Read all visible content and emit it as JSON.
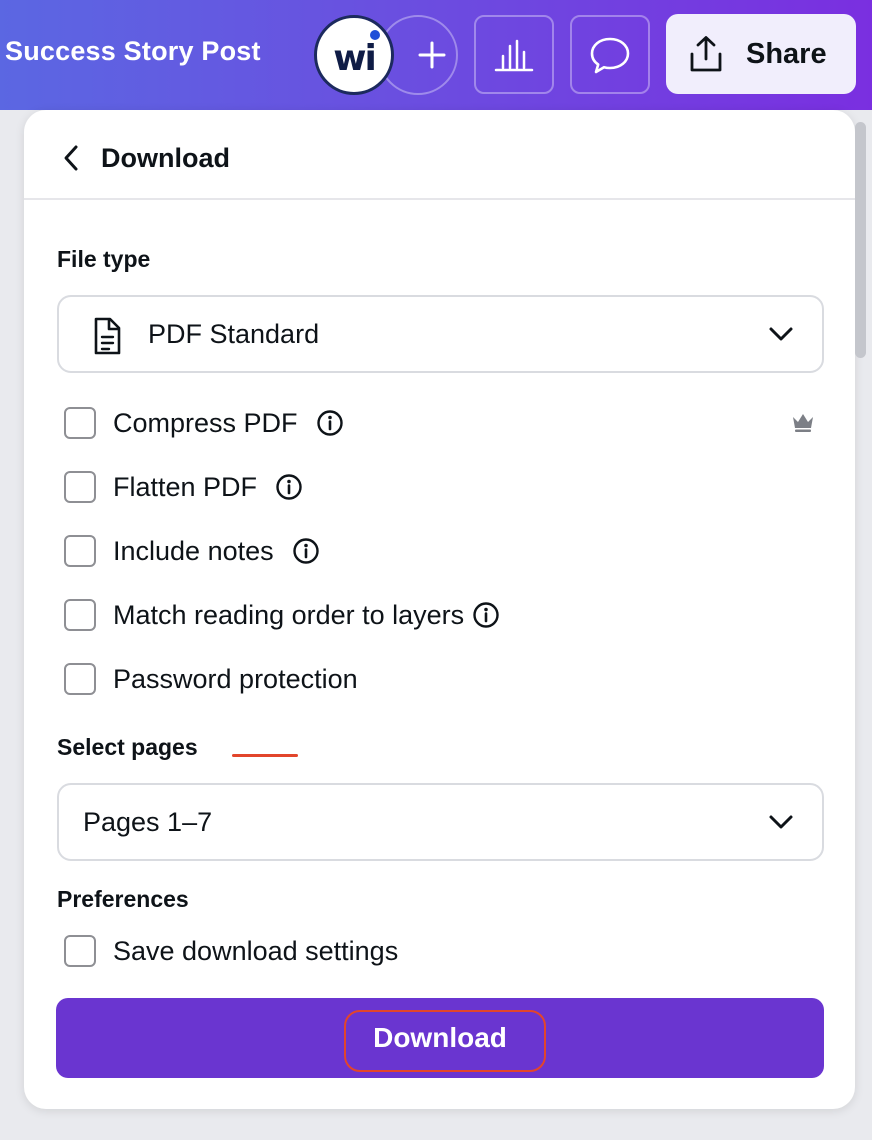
{
  "topbar": {
    "doc_title": "Success Story Post",
    "avatar_initials": "wi",
    "share_label": "Share",
    "icons": [
      "plus-icon",
      "analytics-icon",
      "comment-icon",
      "share-upload-icon"
    ]
  },
  "panel": {
    "title": "Download",
    "file_type": {
      "label": "File type",
      "selected": "PDF Standard",
      "icon": "document-icon"
    },
    "options": [
      {
        "label": "Compress PDF",
        "checked": false,
        "info": true,
        "premium": true
      },
      {
        "label": "Flatten PDF",
        "checked": false,
        "info": true
      },
      {
        "label": "Include notes",
        "checked": false,
        "info": true
      },
      {
        "label": "Match reading order to layers",
        "checked": false,
        "info": true
      },
      {
        "label": "Password protection",
        "checked": false,
        "info": false
      }
    ],
    "select_pages": {
      "label": "Select pages",
      "selected": "Pages 1–7"
    },
    "preferences": {
      "label": "Preferences",
      "save_settings_label": "Save download settings",
      "save_settings_checked": false
    },
    "download_button_label": "Download"
  },
  "colors": {
    "accent": "#6a35d0",
    "annotation": "#e2452b",
    "topbar_start": "#5b67e2",
    "topbar_end": "#7a2fe0"
  }
}
